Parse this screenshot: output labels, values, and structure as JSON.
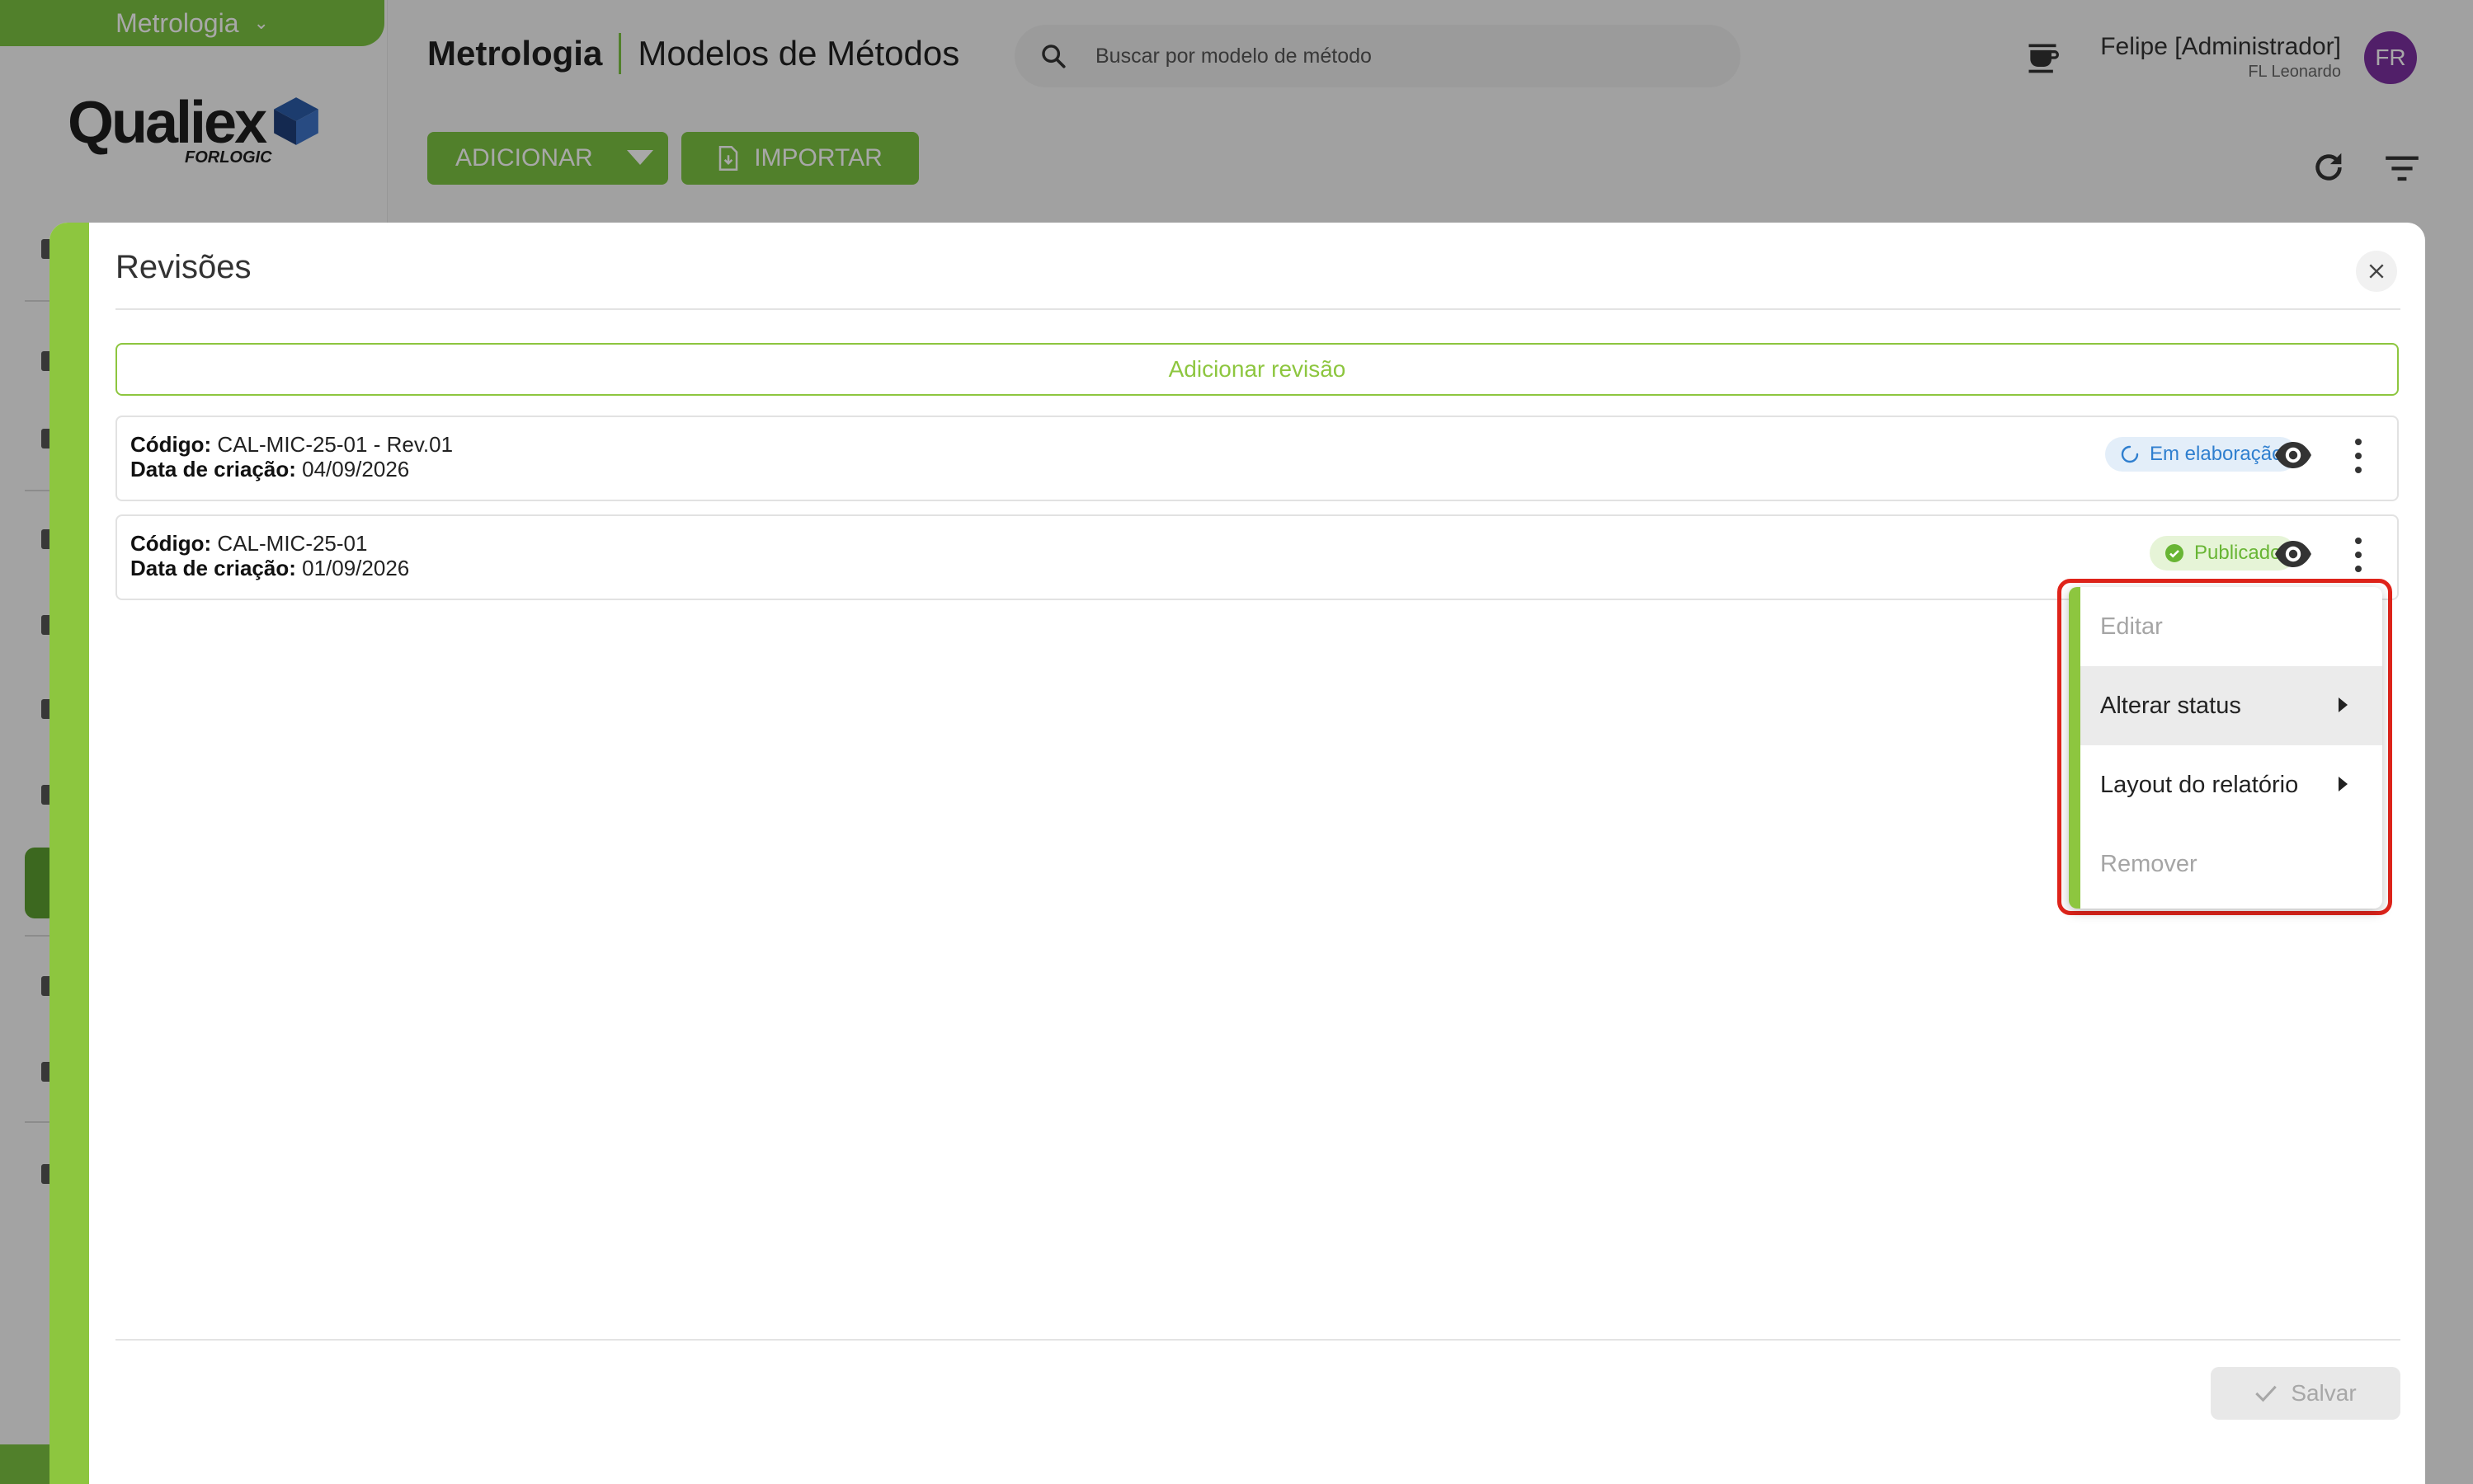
{
  "app": {
    "module_label": "Metrologia",
    "logo_text": "Qualiex",
    "logo_subtext": "FORLOGIC",
    "page_title_strong": "Metrologia",
    "page_title": "Modelos de Métodos",
    "search_placeholder": "Buscar por modelo de método",
    "user_name": "Felipe [Administrador]",
    "user_org": "FL Leonardo",
    "avatar_initials": "FR",
    "add_button_label": "ADICIONAR",
    "import_button_label": "IMPORTAR"
  },
  "modal": {
    "title": "Revisões",
    "add_revision_label": "Adicionar revisão",
    "revisions": [
      {
        "code_label": "Código:",
        "code": "CAL-MIC-25-01 - Rev.01",
        "date_label": "Data de criação:",
        "date": "04/09/2026",
        "status": "Em elaboração"
      },
      {
        "code_label": "Código:",
        "code": "CAL-MIC-25-01",
        "date_label": "Data de criação:",
        "date": "01/09/2026",
        "status": "Publicado"
      }
    ],
    "save_label": "Salvar"
  },
  "context_menu": {
    "items": [
      {
        "label": "Editar",
        "enabled": false
      },
      {
        "label": "Alterar status",
        "enabled": true,
        "submenu": true
      },
      {
        "label": "Layout do relatório",
        "enabled": true,
        "submenu": true
      },
      {
        "label": "Remover",
        "enabled": false
      }
    ]
  },
  "colors": {
    "brand_green": "#7cc242",
    "accent_green": "#8dc63f",
    "draft_blue": "#2f7fcf",
    "published_green": "#68b534",
    "highlight_red": "#e0241b",
    "avatar_purple": "#7b2fa0"
  }
}
